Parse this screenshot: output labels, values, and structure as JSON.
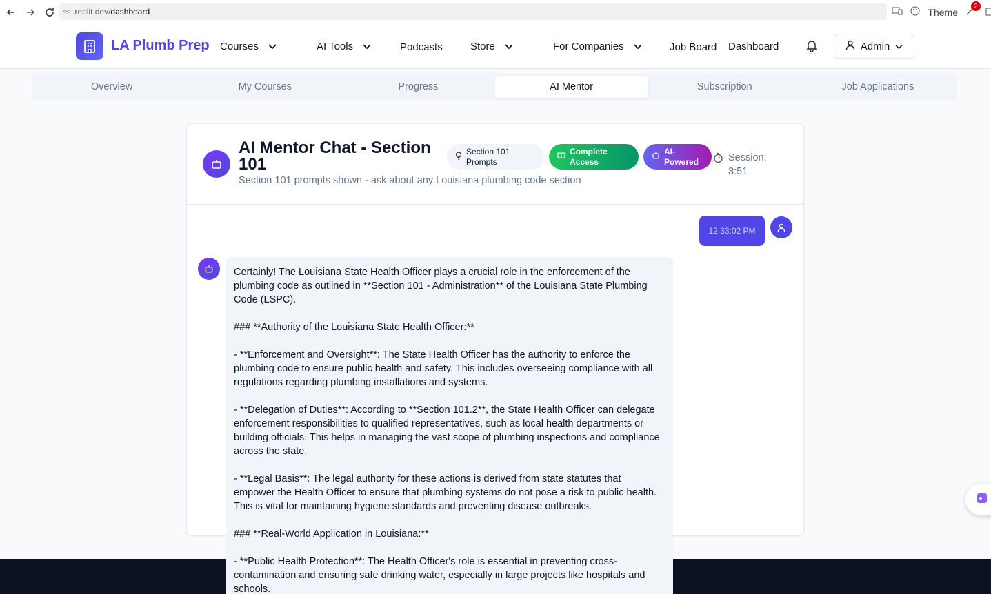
{
  "browser": {
    "url_prefix": ".replit.dev/",
    "url_path": "dashboard",
    "theme_label": "Theme",
    "ext_badge": "2"
  },
  "header": {
    "brand": "LA Plumb Prep",
    "nav": {
      "courses": "Courses",
      "ai_tools": "AI Tools",
      "podcasts": "Podcasts",
      "store": "Store",
      "for_companies": "For Companies",
      "job_board": "Job Board",
      "dashboard": "Dashboard"
    },
    "admin_label": "Admin"
  },
  "tabs": [
    "Overview",
    "My Courses",
    "Progress",
    "AI Mentor",
    "Subscription",
    "Job Applications"
  ],
  "active_tab": "AI Mentor",
  "chat": {
    "title": "AI Mentor Chat - Section 101",
    "subtitle": "Section 101 prompts shown - ask about any Louisiana plumbing code section",
    "pill_prompts": "Section 101 Prompts",
    "pill_access": "Complete Access",
    "pill_ai": "AI-Powered",
    "session": "Session: 3:51",
    "user_time": "12:33:02 PM",
    "bot_message": [
      "Certainly! The Louisiana State Health Officer plays a crucial role in the enforcement of the plumbing code as outlined in **Section 101 - Administration** of the Louisiana State Plumbing Code (LSPC).",
      "### **Authority of the Louisiana State Health Officer:**",
      "- **Enforcement and Oversight**: The State Health Officer has the authority to enforce the plumbing code to ensure public health and safety. This includes overseeing compliance with all regulations regarding plumbing installations and systems.",
      "- **Delegation of Duties**: According to **Section 101.2**, the State Health Officer can delegate enforcement responsibilities to qualified representatives, such as local health departments or building officials. This helps in managing the vast scope of plumbing inspections and compliance across the state.",
      "- **Legal Basis**: The legal authority for these actions is derived from state statutes that empower the Health Officer to ensure that plumbing systems do not pose a risk to public health. This is vital for maintaining hygiene standards and preventing disease outbreaks.",
      "### **Real-World Application in Louisiana:**",
      "- **Public Health Protection**: The Health Officer's role is essential in preventing cross-contamination and ensuring safe drinking water, especially in large projects like hospitals and schools."
    ]
  },
  "colors": {
    "brand": "#4f46e5",
    "green": "#16a34a",
    "purple": "#a21caf",
    "footer": "#0b1120"
  }
}
